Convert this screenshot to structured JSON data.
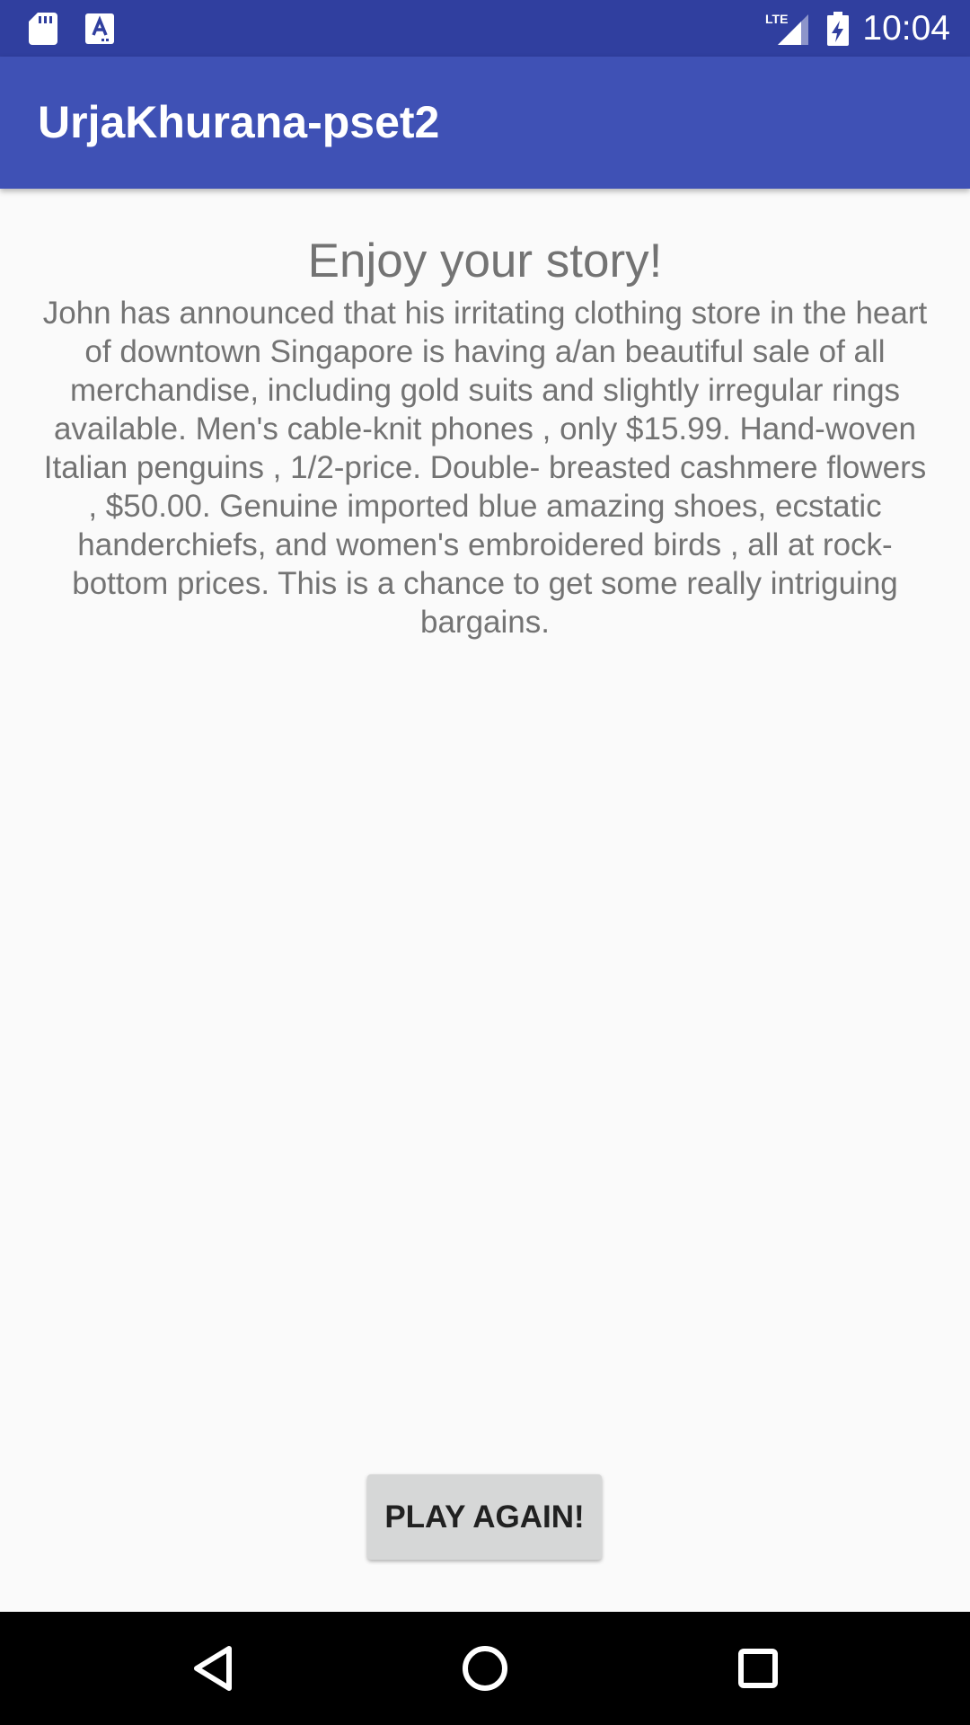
{
  "status_bar": {
    "time": "10:04",
    "icons": [
      "sd-card-icon",
      "a-icon",
      "lte-signal-icon",
      "battery-charging-icon"
    ]
  },
  "app_bar": {
    "title": "UrjaKhurana-pset2"
  },
  "main": {
    "heading": "Enjoy your story!",
    "story": "John has announced that his irritating clothing store in the heart of downtown Singapore is having a/an beautiful sale of all merchandise, including gold suits and slightly irregular rings available. Men's cable-knit phones , only $15.99. Hand-woven Italian penguins , 1/2-price. Double- breasted cashmere flowers , $50.00. Genuine imported blue amazing shoes, ecstatic handerchiefs, and women's embroidered birds , all at rock-bottom prices. This is a chance to get some really intriguing bargains.",
    "play_again_label": "PLAY AGAIN!"
  },
  "nav_bar": {
    "icons": [
      "back-icon",
      "home-icon",
      "recents-icon"
    ]
  },
  "colors": {
    "status_bar": "#303f9f",
    "app_bar": "#3f51b5",
    "background": "#fafafa",
    "text": "#737373",
    "button": "#d6d7d7"
  }
}
